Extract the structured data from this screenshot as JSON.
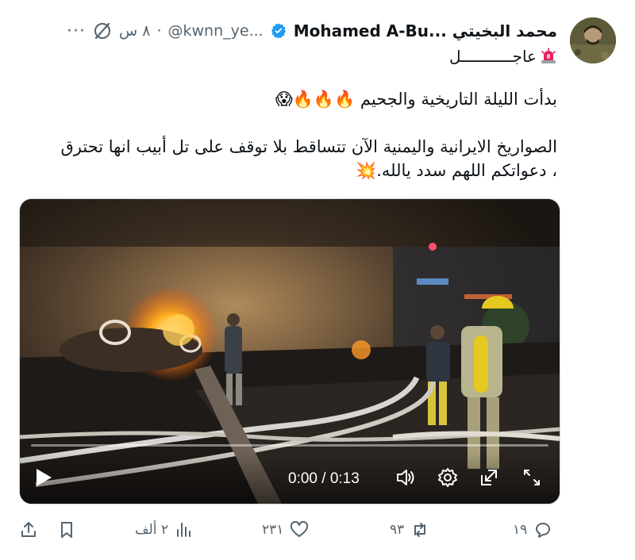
{
  "author": {
    "display_name": "Mohamed A-Bu... محمد البخيتي",
    "handle": "@kwnn_ye...",
    "separator": "·",
    "time": "٨ س",
    "more_label": "···"
  },
  "tweet": {
    "headline": "عاجـــــــــــل",
    "lines": [
      "بدأت الليلة التاريخية والجحيم 🔥🔥🔥😱",
      "",
      "الصواريخ الايرانية واليمنية الآن تتساقط بلا توقف على تل أبيب انها تحترق",
      "، دعواتكم اللهم سدد يالله.💥"
    ]
  },
  "video": {
    "time_readout": "0:00 / 0:13",
    "progress": 0
  },
  "actions": {
    "replies": "١٩",
    "reposts": "٩٣",
    "likes": "٢٣١",
    "views": "٢ ألف"
  },
  "colors": {
    "text": "#0f1419",
    "secondary": "#536471",
    "verified": "#1d9bf0",
    "siren": "#e0245e"
  }
}
